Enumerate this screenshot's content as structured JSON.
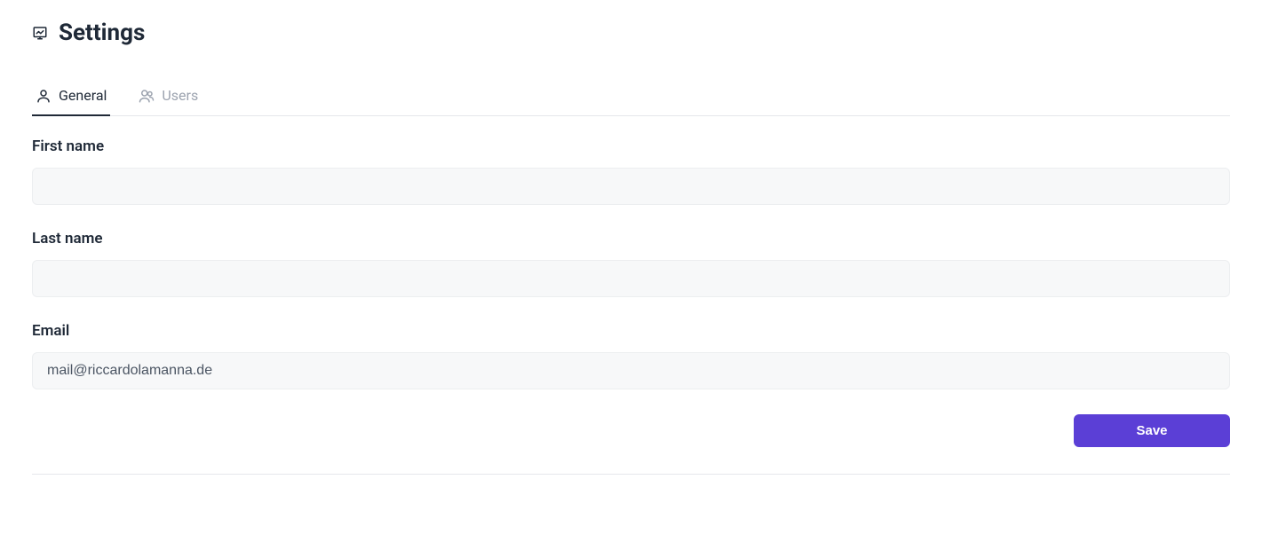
{
  "header": {
    "title": "Settings"
  },
  "tabs": {
    "general": "General",
    "users": "Users"
  },
  "form": {
    "first_name": {
      "label": "First name",
      "value": ""
    },
    "last_name": {
      "label": "Last name",
      "value": ""
    },
    "email": {
      "label": "Email",
      "value": "mail@riccardolamanna.de"
    }
  },
  "actions": {
    "save_label": "Save"
  }
}
